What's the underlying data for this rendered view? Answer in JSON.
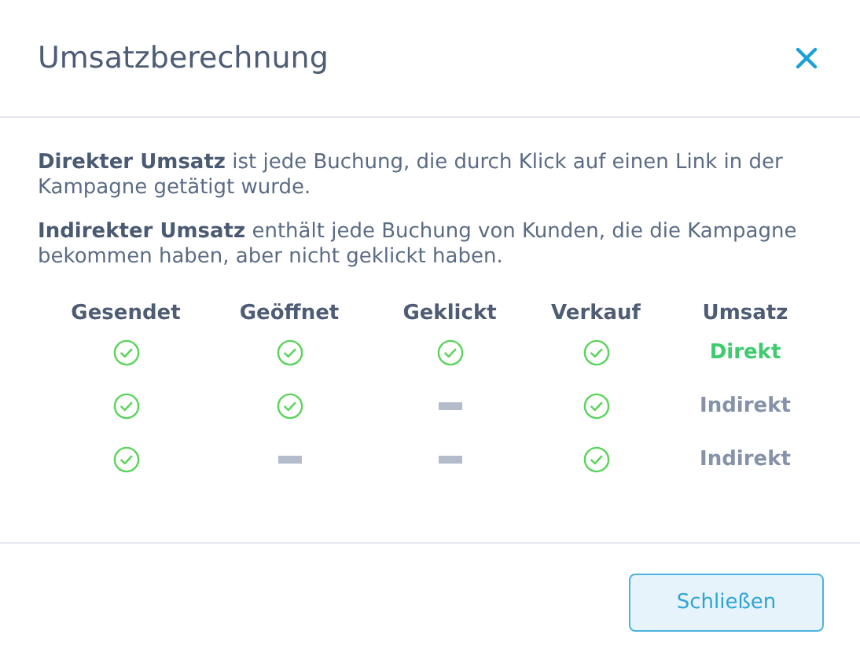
{
  "dialog": {
    "title": "Umsatzberechnung"
  },
  "paragraphs": [
    "**Direkter Umsatz** ist jede Buchung, die durch Klick auf einen Link in der Kampagne getätigt wurde.",
    "**Indirekter Umsatz** enthält jede Buchung von Kunden, die die Kampagne bekommen haben, aber nicht geklickt haben."
  ],
  "table": {
    "columns": [
      "Gesendet",
      "Geöffnet",
      "Geklickt",
      "Verkauf",
      "Umsatz"
    ],
    "rows": [
      {
        "steps": [
          true,
          true,
          true,
          true
        ],
        "result": {
          "text": "Direkt",
          "kind": "direct"
        }
      },
      {
        "steps": [
          true,
          true,
          false,
          true
        ],
        "result": {
          "text": "Indirekt",
          "kind": "indirect"
        }
      },
      {
        "steps": [
          true,
          false,
          false,
          true
        ],
        "result": {
          "text": "Indirekt",
          "kind": "indirect"
        }
      }
    ]
  },
  "buttons": [
    "Schließen"
  ]
}
